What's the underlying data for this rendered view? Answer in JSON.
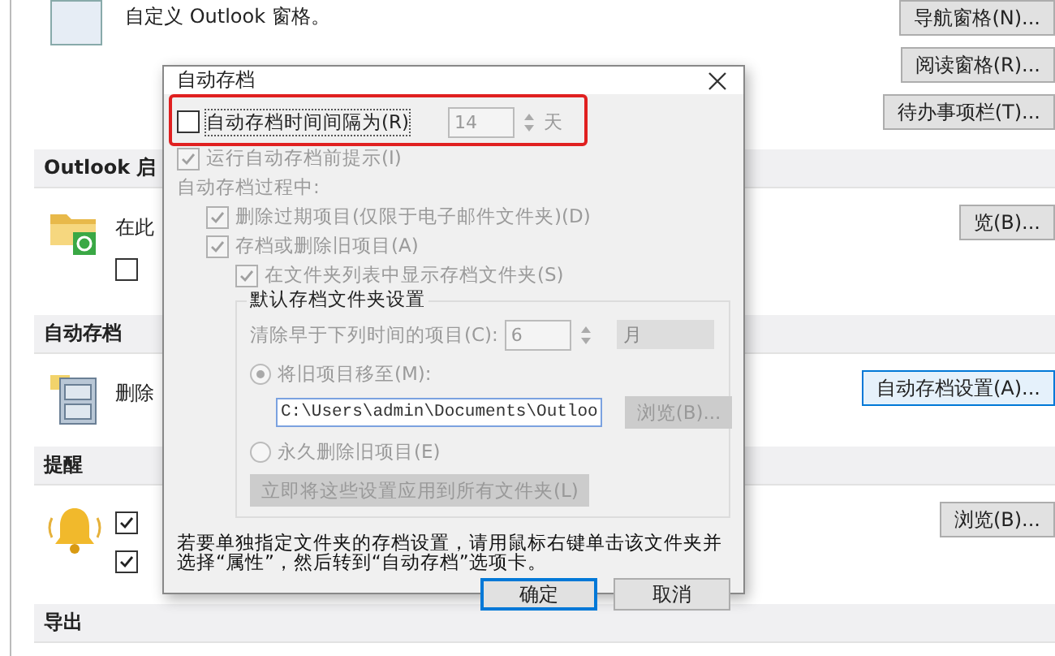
{
  "background": {
    "panes_text": "自定义 Outlook 窗格。",
    "pane_buttons": [
      "导航窗格(N)...",
      "阅读窗格(R)...",
      "待办事项栏(T)..."
    ],
    "sections": [
      {
        "title": "Outlook 启",
        "kind": "folder",
        "rows": [
          {
            "kind": "text",
            "text": "在此"
          },
          {
            "kind": "check",
            "checked": false
          }
        ],
        "button": {
          "label": "览(B)...",
          "focused": false
        }
      },
      {
        "title": "自动存档",
        "kind": "cabinet",
        "rows": [
          {
            "kind": "text",
            "text": "删除"
          }
        ],
        "button": {
          "label": "自动存档设置(A)...",
          "focused": true
        }
      },
      {
        "title": "提醒",
        "kind": "bell",
        "rows": [
          {
            "kind": "check",
            "checked": true
          },
          {
            "kind": "check",
            "checked": true
          }
        ],
        "button": {
          "label": "浏览(B)...",
          "focused": false
        }
      },
      {
        "title": "导出"
      }
    ]
  },
  "dialog": {
    "title": "自动存档",
    "interval": {
      "label": "自动存档时间间隔为(R)",
      "checked": false,
      "value": "14",
      "unit": "天",
      "highlighted": true
    },
    "options": [
      {
        "kind": "check",
        "label": "运行自动存档前提示(I)",
        "checked": true,
        "disabled": true
      },
      {
        "kind": "text",
        "label": "自动存档过程中:",
        "disabled": true,
        "children": [
          {
            "kind": "check",
            "label": "删除过期项目(仅限于电子邮件文件夹)(D)",
            "checked": true,
            "disabled": true
          },
          {
            "kind": "check",
            "label": "存档或删除旧项目(A)",
            "checked": true,
            "disabled": true,
            "children": [
              {
                "kind": "check",
                "label": "在文件夹列表中显示存档文件夹(S)",
                "checked": true,
                "disabled": true
              }
            ]
          }
        ]
      }
    ],
    "group": {
      "title": "默认存档文件夹设置",
      "clean_label": "清除早于下列时间的项目(C):",
      "clean_value": "6",
      "clean_unit": "月",
      "radios": [
        {
          "label": "将旧项目移至(M):",
          "selected": true
        },
        {
          "label": "永久删除旧项目(E)",
          "selected": false
        }
      ],
      "path": "C:\\Users\\admin\\Documents\\Outloo",
      "browse": "浏览(B)...",
      "apply": "立即将这些设置应用到所有文件夹(L)"
    },
    "note": "若要单独指定文件夹的存档设置，请用鼠标右键单击该文件夹并选择“属性”，然后转到“自动存档”选项卡。",
    "buttons": [
      {
        "label": "确定",
        "default": true
      },
      {
        "label": "取消",
        "default": false
      }
    ]
  }
}
